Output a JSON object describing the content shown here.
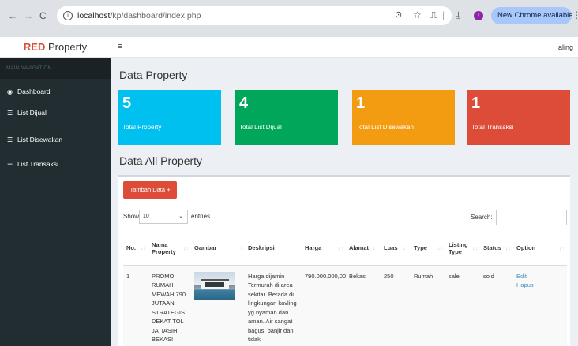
{
  "browser": {
    "url_host": "localhost",
    "url_path": "/kp/dashboard/index.php",
    "update_label": "New Chrome available",
    "back_glyph": "←",
    "forward_glyph": "→",
    "reload_glyph": "C",
    "info_glyph": "i",
    "key_glyph": "⊙",
    "star_glyph": "☆",
    "ext_glyph": "⎍",
    "sep_glyph": "|",
    "download_glyph": "⤓",
    "profile_glyph": "!",
    "menu_glyph": "⋮"
  },
  "header": {
    "logo_bold": "RED",
    "logo_rest": " Property",
    "hamburger_glyph": "≡",
    "user": "aling"
  },
  "sidebar": {
    "header": "MAIN NAVIGATION",
    "items": [
      {
        "label": "Dashboard",
        "icon": "dashboard-icon",
        "glyph": "◉"
      },
      {
        "label": "List Dijual",
        "icon": "list-icon",
        "glyph": "☰"
      },
      {
        "label": "List Disewakan",
        "icon": "list-icon",
        "glyph": "☰"
      },
      {
        "label": "List Transaksi",
        "icon": "list-icon",
        "glyph": "☰"
      }
    ]
  },
  "page": {
    "title": "Data Property",
    "section_title": "Data All Property"
  },
  "stats": [
    {
      "value": "5",
      "label": "Total Property",
      "color": "#00c0ef"
    },
    {
      "value": "4",
      "label": "Total List Dijual",
      "color": "#00a65a"
    },
    {
      "value": "1",
      "label": "Total List Disewakan",
      "color": "#f39c12"
    },
    {
      "value": "1",
      "label": "Total Transaksi",
      "color": "#dd4b39"
    }
  ],
  "table_controls": {
    "add_button": "Tambah Data +",
    "show_label": "Show",
    "entries_value": "10",
    "chevron_glyph": "⌄",
    "entries_label": "entries",
    "search_label": "Search:"
  },
  "table": {
    "sort_glyph": "↓↑",
    "headers": [
      "No.",
      "Nama Property",
      "Gambar",
      "Deskripsi",
      "Harga",
      "Alamat",
      "Luas",
      "Type",
      "Listing Type",
      "Status",
      "Option"
    ],
    "rows": [
      {
        "no": "1",
        "nama": "PROMO! RUMAH MEWAH 790 JUTAAN STRATEGIS DEKAT TOL JATIASIH BEKASI",
        "deskripsi": "Harga dijamin Termurah di area sekitar. Berada di lingkungan kavling yg nyaman dan aman. Air sangat bagus, banjir dan tidak",
        "harga": "790.000.000,00",
        "alamat": "Bekasi",
        "luas": "250",
        "type": "Rumah",
        "listing_type": "sale",
        "status": "sold",
        "edit": "Edit",
        "hapus": "Hapus"
      }
    ]
  }
}
